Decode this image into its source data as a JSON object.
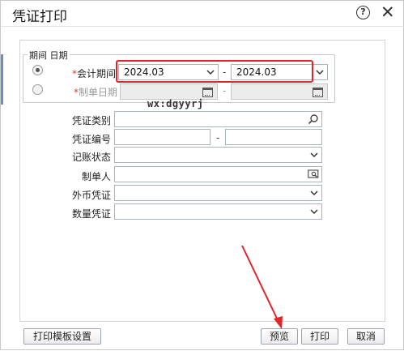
{
  "dialog": {
    "title": "凭证打印",
    "help_icon_glyph": "?",
    "close_icon_glyph": "✕"
  },
  "period_group": {
    "legend": "期间 日期",
    "accounting_period": {
      "required_mark": "*",
      "label": "会计期间",
      "from_value": "2024.03",
      "separator": "-",
      "to_value": "2024.03",
      "selected": true
    },
    "document_date": {
      "required_mark": "*",
      "label": "制单日期",
      "separator": "-",
      "selected": false
    }
  },
  "watermark_text": "wx:dgyyrj",
  "filters": {
    "voucher_type_label": "凭证类别",
    "voucher_number_label": "凭证编号",
    "voucher_number_separator": "-",
    "posting_status_label": "记账状态",
    "creator_label": "制单人",
    "foreign_currency_label": "外币凭证",
    "quantity_voucher_label": "数量凭证"
  },
  "buttons": {
    "print_template_settings": "打印模板设置",
    "preview": "预览",
    "print": "打印",
    "cancel": "取消"
  },
  "colors": {
    "highlight": "#e0262b",
    "annotation_arrow": "#e0262b",
    "panel_border": "#cfd6de"
  },
  "icons": {
    "chevron": "chevron-down-icon",
    "calendar": "calendar-icon",
    "search": "search-icon",
    "lookup": "lookup-icon"
  }
}
